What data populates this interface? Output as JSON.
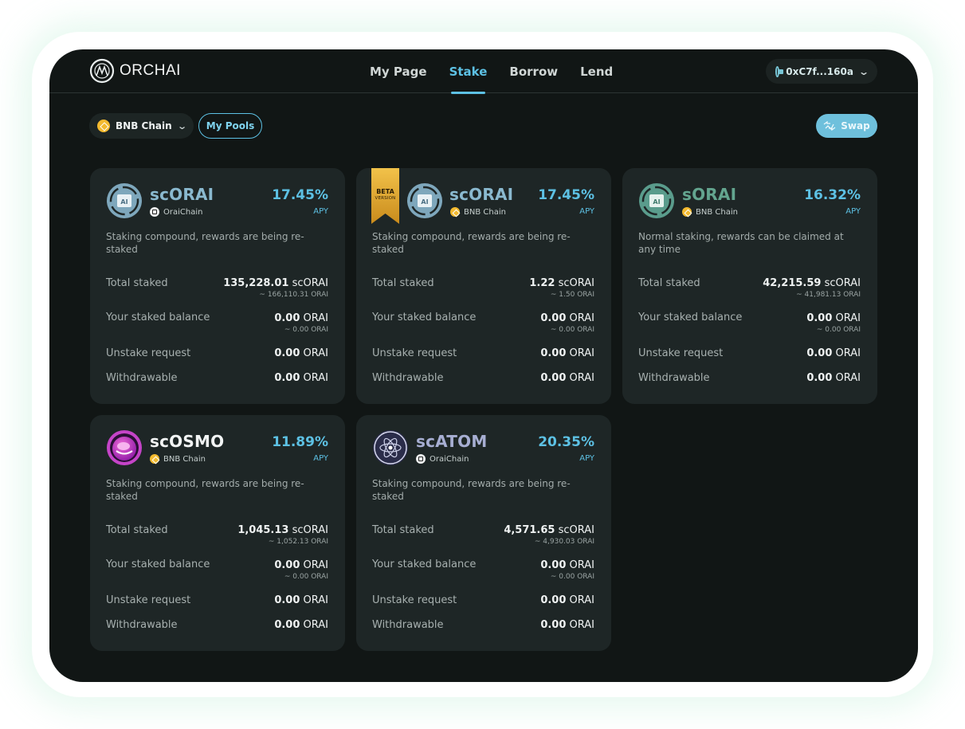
{
  "app": {
    "brand": "ORCHAI",
    "nav": [
      "My Page",
      "Stake",
      "Borrow",
      "Lend"
    ],
    "active_nav": "Stake",
    "wallet_address": "0xC7f...160a"
  },
  "toolbar": {
    "chain_select": "BNB Chain",
    "my_pools": "My Pools",
    "swap": "Swap"
  },
  "labels": {
    "apy": "APY",
    "total_staked": "Total staked",
    "your_staked_balance": "Your staked balance",
    "unstake_request": "Unstake request",
    "withdrawable": "Withdrawable"
  },
  "colors": {
    "accent": "#5dc1e4",
    "card_bg": "#1e2626",
    "frame_bg": "#111615",
    "bnb": "#f3ba2f",
    "beta_gold": "#e2a72e"
  },
  "pools": [
    {
      "token": "scORAI",
      "chain": "OraiChain",
      "chain_icon": "oraichain-icon",
      "icon": "orai-icon",
      "beta": false,
      "apy": "17.45%",
      "description": "Staking compound, rewards are being re-staked",
      "total_staked": "135,228.01",
      "total_staked_unit": "scORAI",
      "total_staked_sub": "~ 166,110.31 ORAI",
      "balance": "0.00",
      "balance_unit": "ORAI",
      "balance_sub": "~ 0.00 ORAI",
      "unstake": "0.00",
      "unstake_unit": "ORAI",
      "withdrawable": "0.00",
      "withdrawable_unit": "ORAI"
    },
    {
      "token": "scORAI",
      "chain": "BNB Chain",
      "chain_icon": "bnb-icon",
      "icon": "orai-icon",
      "beta": true,
      "beta_label": "BETA",
      "beta_sub": "VERSION",
      "apy": "17.45%",
      "description": "Staking compound, rewards are being re-staked",
      "total_staked": "1.22",
      "total_staked_unit": "scORAI",
      "total_staked_sub": "~ 1.50 ORAI",
      "balance": "0.00",
      "balance_unit": "ORAI",
      "balance_sub": "~ 0.00 ORAI",
      "unstake": "0.00",
      "unstake_unit": "ORAI",
      "withdrawable": "0.00",
      "withdrawable_unit": "ORAI"
    },
    {
      "token": "sORAI",
      "chain": "BNB Chain",
      "chain_icon": "bnb-icon",
      "icon": "orai-green-icon",
      "beta": false,
      "apy": "16.32%",
      "description": "Normal staking, rewards can be claimed at any time",
      "total_staked": "42,215.59",
      "total_staked_unit": "scORAI",
      "total_staked_sub": "~ 41,981.13 ORAI",
      "balance": "0.00",
      "balance_unit": "ORAI",
      "balance_sub": "~ 0.00 ORAI",
      "unstake": "0.00",
      "unstake_unit": "ORAI",
      "withdrawable": "0.00",
      "withdrawable_unit": "ORAI"
    },
    {
      "token": "scOSMO",
      "chain": "BNB Chain",
      "chain_icon": "bnb-icon",
      "icon": "osmo-icon",
      "beta": false,
      "apy": "11.89%",
      "description": "Staking compound, rewards are being re-staked",
      "total_staked": "1,045.13",
      "total_staked_unit": "scORAI",
      "total_staked_sub": "~ 1,052.13 ORAI",
      "balance": "0.00",
      "balance_unit": "ORAI",
      "balance_sub": "~ 0.00 ORAI",
      "unstake": "0.00",
      "unstake_unit": "ORAI",
      "withdrawable": "0.00",
      "withdrawable_unit": "ORAI"
    },
    {
      "token": "scATOM",
      "chain": "OraiChain",
      "chain_icon": "oraichain-icon",
      "icon": "atom-icon",
      "beta": false,
      "apy": "20.35%",
      "description": "Staking compound, rewards are being re-staked",
      "total_staked": "4,571.65",
      "total_staked_unit": "scORAI",
      "total_staked_sub": "~ 4,930.03 ORAI",
      "balance": "0.00",
      "balance_unit": "ORAI",
      "balance_sub": "~ 0.00 ORAI",
      "unstake": "0.00",
      "unstake_unit": "ORAI",
      "withdrawable": "0.00",
      "withdrawable_unit": "ORAI"
    }
  ]
}
